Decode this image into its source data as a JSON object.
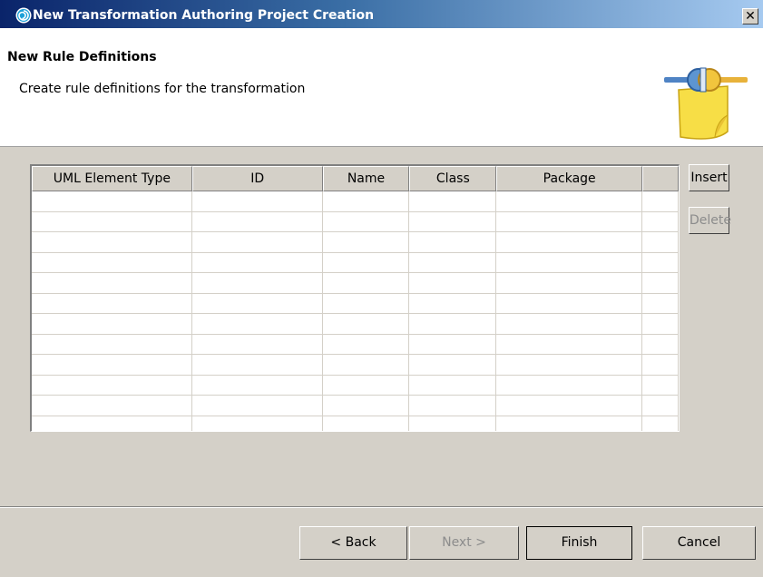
{
  "window": {
    "title": "New Transformation Authoring Project Creation",
    "close_label": "✕"
  },
  "header": {
    "title": "New Rule Definitions",
    "description": "Create rule definitions for the transformation"
  },
  "table": {
    "columns": [
      "UML Element Type",
      "ID",
      "Name",
      "Class",
      "Package",
      ""
    ],
    "row_count": 12
  },
  "side_buttons": {
    "insert": "Insert",
    "delete": "Delete"
  },
  "footer": {
    "back": "< Back",
    "next": "Next >",
    "finish": "Finish",
    "cancel": "Cancel"
  },
  "colors": {
    "title_bar_start": "#0a246a",
    "title_bar_end": "#a6caf0",
    "dialog_bg": "#d4d0c8",
    "disabled_text": "#8c8c8c"
  }
}
